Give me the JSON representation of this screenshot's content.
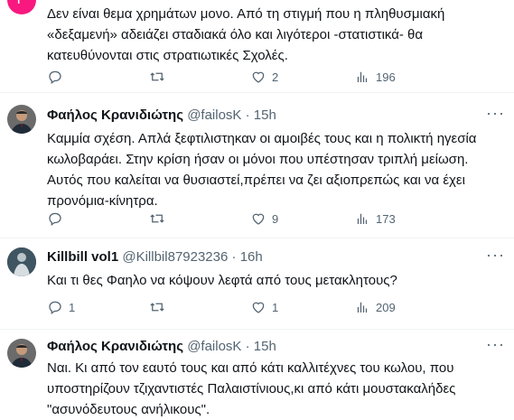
{
  "tweets": [
    {
      "name": "",
      "handle": "",
      "time": "",
      "text": [
        "Δεν είναι θεμα χρημάτων μονο. Από τη στιγμή που η πληθυσμιακή",
        "«δεξαμενή» αδειάζει σταδιακά όλο και λιγότεροι -στατιστικά- θα",
        "κατευθύνονται στις στρατιωτικές Σχολές."
      ],
      "replies": "",
      "retweets": "",
      "likes": "2",
      "views": "196",
      "avatar_letter": "P"
    },
    {
      "name": "Φαήλος Κρανιδιώτης",
      "handle": "@failosK",
      "time": "15h",
      "text": [
        "Καμμία σχέση. Απλά ξεφτιλιστηκαν οι αμοιβές τους και η πολικτή ηγεσία",
        "κωλοβαράει. Στην κρίση ήσαν οι μόνοι που υπέστησαν τριπλή μείωση.",
        "Αυτός που καλείται να θυσιαστεί,πρέπει να ζει αξιοπρεπώς και να έχει",
        "προνόμια-κίνητρα."
      ],
      "replies": "",
      "retweets": "",
      "likes": "9",
      "views": "173"
    },
    {
      "name": "Killbill vol1",
      "handle": "@Killbil87923236",
      "time": "16h",
      "text": [
        "Και τι θες Φαηλο να κόψουν λεφτά από τους μετακλητους?"
      ],
      "replies": "1",
      "retweets": "",
      "likes": "1",
      "views": "209"
    },
    {
      "name": "Φαήλος Κρανιδιώτης",
      "handle": "@failosK",
      "time": "15h",
      "text": [
        "Ναι. Κι από τον εαυτό τους και από κάτι καλλιτέχνες του κωλου, που",
        "υποστηρίζουν τζιχαντιστές Παλαιστίνιους,κι από κάτι μουστακαλήδες",
        "\"ασυνόδευτους ανήλικους\"."
      ]
    }
  ],
  "separator_dot": "·",
  "more_label": "···"
}
